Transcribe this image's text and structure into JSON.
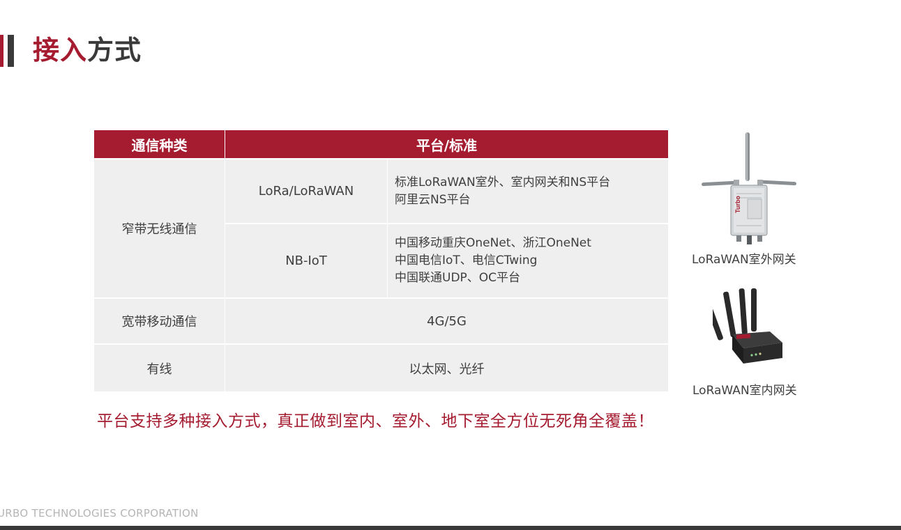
{
  "header": {
    "title_accent": "接入",
    "title_rest": "方式"
  },
  "table": {
    "col_headers": [
      "通信种类",
      "平台/标准"
    ],
    "narrowband": {
      "category": "窄带无线通信",
      "rows": [
        {
          "tech": "LoRa/LoRaWAN",
          "platforms": [
            "标准LoRaWAN室外、室内网关和NS平台",
            "阿里云NS平台"
          ]
        },
        {
          "tech": "NB-IoT",
          "platforms": [
            "中国移动重庆OneNet、浙江OneNet",
            "中国电信IoT、电信CTwing",
            "中国联通UDP、OC平台"
          ]
        }
      ]
    },
    "broadband": {
      "category": "宽带移动通信",
      "value": "4G/5G"
    },
    "wired": {
      "category": "有线",
      "value": "以太网、光纤"
    }
  },
  "tagline": "平台支持多种接入方式，真正做到室内、室外、地下室全方位无死角全覆盖！",
  "devices": {
    "outdoor": {
      "caption": "LoRaWAN室外网关",
      "badge": "Turbo"
    },
    "indoor": {
      "caption": "LoRaWAN室内网关"
    }
  },
  "footer": {
    "company": "URBO TECHNOLOGIES CORPORATION"
  },
  "colors": {
    "accent": "#a51c30",
    "dark": "#3a3a3a",
    "cell_bg": "#efefef"
  }
}
